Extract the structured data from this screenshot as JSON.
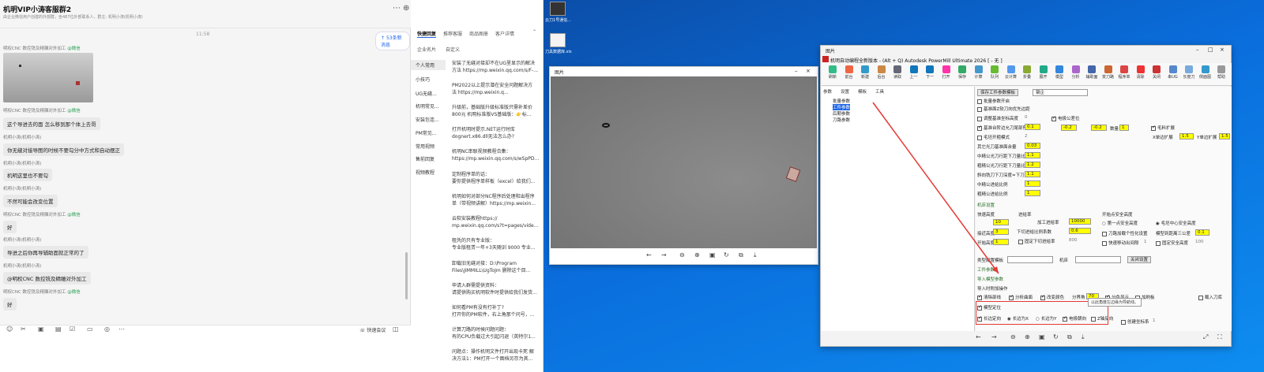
{
  "chat": {
    "title": "机明VIP小涛客服群2",
    "member_count": "8",
    "subtitle": "由企业微信用户创建的外部群，含487位外部联系人，群主: 机明小涛(机明小涛)",
    "time": "11:58",
    "unread_label": "53条新消息",
    "messages": [
      {
        "sender": "明权CNC 数控铣及精雕对外加工",
        "tag": "@微信"
      },
      {
        "sender": "明权CNC 数控铣及精雕对外加工",
        "tag": "@微信",
        "text": "这个导进去的面 怎么移到那个体上去哥"
      },
      {
        "sender": "机明小涛(机明小涛)",
        "text": "你无缝对接导图的时候不要勾分中方式和自动摆正"
      },
      {
        "sender": "机明小涛(机明小涛)",
        "text": "机明这里也不要勾"
      },
      {
        "sender": "机明小涛(机明小涛)",
        "text": "不然可能会改变位置"
      },
      {
        "sender": "明权CNC 数控铣及精雕对外加工",
        "tag": "@微信",
        "text": "好"
      },
      {
        "sender": "机明小涛(机明小涛)",
        "text": "导进之后你再导辅助面就正常的了"
      },
      {
        "sender": "机明小涛(机明小涛)",
        "text": "@明权CNC 数控铣及精雕对外加工"
      },
      {
        "sender": "明权CNC 数控铣及精雕对外加工",
        "tag": "@微信",
        "text": "好"
      }
    ],
    "compose": {
      "quick_meeting": "快速会议"
    }
  },
  "quick_reply": {
    "tabs": [
      "快捷回复",
      "推荐客服",
      "商品图册",
      "客户详情"
    ],
    "subtabs": [
      "企业名片",
      "自定义"
    ],
    "categories": [
      "个人常用",
      "小技巧",
      "UG无缝...",
      "机明常见...",
      "安装包连...",
      "PM常见...",
      "常用视频",
      "售前回复",
      "视频教程"
    ],
    "replies": [
      [
        "安装了无缝对接却不在UG里显示的解决",
        "方法 https://mp.weixin.qq.com/s/F-..."
      ],
      [
        "PM2022以上提示潜在安全问题解决方",
        "法          https://mp.weixin.q..."
      ],
      [
        "升级前，基础版升级标准版只需补差价",
        "800元 机明标准版VS基础版：👉标..."
      ],
      [
        "打开机明时提示.NET运行时库",
        "dognert.x86.dll无法怎么办?"
      ],
      [
        "机明NC串联视频教程合集：",
        "https://mp.weixin.qq.com/s/wSpPD..."
      ],
      [
        "定制程序单的话：",
        "要你提供程序单样板（excel）给我们..."
      ],
      [
        "机明如何对部分NC程序后处理和出程序",
        "单（带视频讲解）https://mp.weixin..."
      ],
      [
        "云软安装教程https://",
        "mp.weixin.qq.com/s?t=pages/vide..."
      ],
      [
        "租凭的只有专业版：",
        "专业版租赁一年+3天随训 9000 专业..."
      ],
      [
        "卸载旧无缝对接：D:\\Program",
        "Files\\JIMMILL\\UgToJm 删除这个目..."
      ],
      [
        "申请入群需提供资料：",
        "请提供购买机明软件时提供给我们发货..."
      ],
      [
        "如何看PM有没有打补丁?",
        "打开你的PM软件，右上角那个问号，..."
      ],
      [
        "计算刀路的时候问题问题：",
        "有的CPU负载过大引起闪退（英特尔1..."
      ],
      [
        "问题点：操作机明文件打开出现卡死 解",
        "决方法1：PM打开一个图档另存为其..."
      ]
    ]
  },
  "desktop": {
    "icons": [
      {
        "label": "云刀1号通信..."
      },
      {
        "label": "刀具数据库.xls"
      }
    ]
  },
  "viewer1": {
    "title": "图片"
  },
  "viewer2": {
    "title": "图片",
    "pm_title": "机明自动编程全新版本 - (Alt + Q) Autodesk PowerMill Ultimate 2026  [ - 无 ]",
    "ribbon": [
      "刷新",
      "前台",
      "新建",
      "后台",
      "读取",
      "上一",
      "下一",
      "打开",
      "保存",
      "计算",
      "队列",
      "云计算",
      "折叠",
      "展开",
      "模型",
      "分析",
      "辅助面",
      "变刀路",
      "程序单",
      "清除",
      "关闭",
      "串UG",
      "长度刀",
      "侧面图",
      "帮助"
    ],
    "tree_tabs": [
      "参数",
      "设置",
      "模板",
      "工具"
    ],
    "tree_items": [
      "批量参数",
      "工件参数",
      "后期参数",
      "刀路参数"
    ],
    "params": {
      "save_template": "保存工件参数模板",
      "template_value": "钢企",
      "rows": [
        {
          "label": "批量参数开启",
          "checked": false
        },
        {
          "label": "基准面Z软刀向优先边距",
          "checked": false
        },
        {
          "label": "调整基准坐标高度",
          "value": "0"
        },
        {
          "label": "基准台阶边允刀尾部预留",
          "checked": true,
          "value": "0.1"
        },
        {
          "label": "毛坯开粗模式",
          "value": "2"
        },
        {
          "label": "其它光刀基准面余量",
          "value": "0.03"
        },
        {
          "label": "中精公光刀行距下刀量比例",
          "value": "1.1"
        },
        {
          "label": "粗精公光刀行距下刀量比例",
          "value": "1.2"
        },
        {
          "label": "斜向铣刀下刀深度=下刀量比",
          "value": "1.1"
        },
        {
          "label": "中精公进给比例",
          "value": "1"
        },
        {
          "label": "粗精公进给比例",
          "value": "1"
        }
      ],
      "offset_label": "电极公差位",
      "offset_x": "-0.2",
      "offset_y": "-0.2",
      "qty_label": "数量",
      "qty": "1",
      "blank_expand": "毛料扩展",
      "x_expand_label": "X单边扩展",
      "x_expand": "1.5",
      "y_expand_label": "Y单边扩展",
      "y_expand": "1.5",
      "machine_section": "机床设置",
      "safe_height": "快速高度",
      "safe_height_val": "10",
      "approach_label": "接近高度",
      "approach_val": "3",
      "start_label": "开始高度",
      "start_val": "1",
      "feed_label": "进给率",
      "feed_cut_label": "加工进给率",
      "feed_cut_val": "10000",
      "feed_plunge_label": "下切进给比例系数",
      "feed_plunge_val": "0.6",
      "feed_fix_label": "固定下切进给率",
      "feed_fix_val": "800",
      "start_point_label": "开始点安全高度",
      "radio1": "第一点安全高度",
      "radio2": "毛坯中心安全高度",
      "tool_check": "刀路加载个性化设置",
      "model_dist_label": "模型到距离三公差",
      "model_dist_val": "0.1",
      "fast_gap_label": "快速移动出间隙",
      "fast_gap_val": "1",
      "fix_safe_label": "固定安全高度",
      "fix_safe_val": "100",
      "machine_cfg": "类型配置模板",
      "machine": "机床",
      "pick_btn": "关闭设置",
      "tool_param": "工件参数",
      "import_section": "导入模型参数",
      "import_op": "导入时附加操作",
      "op1": "清除部线",
      "op2": "分析曲面",
      "op3": "改变颜色",
      "op4": "分界角",
      "op4_val": "70",
      "op5": "分色显示",
      "op6": "加刷板",
      "op7": "载入刀库",
      "model_locate": "模型定位",
      "long_side": "长边定向",
      "r1": "长边为X",
      "r2": "长边为Y",
      "r3": "电极朝向",
      "z_dir": "Z轴反向",
      "create_coord": "创建坐标系",
      "create_coord_val": "1",
      "tooltip": "以此角度左边缘为导航线。"
    }
  }
}
